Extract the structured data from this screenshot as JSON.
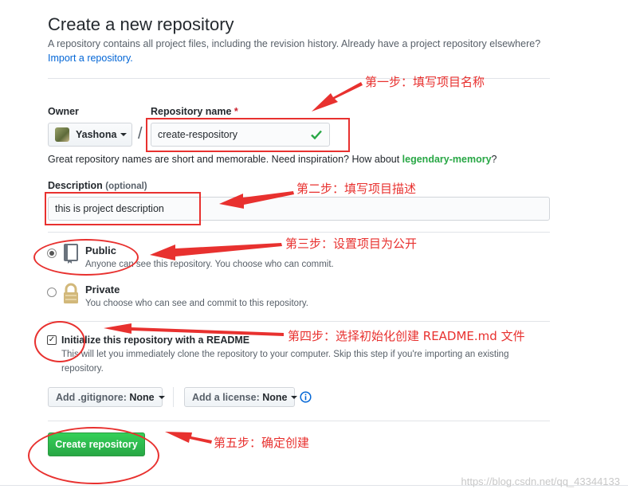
{
  "header": {
    "title": "Create a new repository",
    "description": "A repository contains all project files, including the revision history. Already have a project repository elsewhere?",
    "import_link": "Import a repository."
  },
  "owner": {
    "label": "Owner",
    "value": "Yashona"
  },
  "repo_name": {
    "label": "Repository name",
    "required_mark": "*",
    "separator": "/",
    "value": "create-respository",
    "hint_prefix": "Great repository names are short and memorable. Need inspiration? How about ",
    "suggestion": "legendary-memory",
    "hint_suffix": "?"
  },
  "description": {
    "label": "Description",
    "optional": "(optional)",
    "value": "this is project description"
  },
  "visibility": {
    "public": {
      "label": "Public",
      "desc": "Anyone can see this repository. You choose who can commit.",
      "selected": true
    },
    "private": {
      "label": "Private",
      "desc": "You choose who can see and commit to this repository.",
      "selected": false
    }
  },
  "readme": {
    "label": "Initialize this repository with a README",
    "desc_line1": "This will let you immediately clone the repository to your computer. Skip this step if you're importing an existing",
    "desc_line2": "repository.",
    "checked": true
  },
  "gitignore": {
    "label": "Add .gitignore:",
    "value": "None"
  },
  "license": {
    "label": "Add a license:",
    "value": "None"
  },
  "info_icon": "info-icon",
  "submit": {
    "label": "Create repository"
  },
  "annotations": {
    "step1": "第一步：填写项目名称",
    "step2": "第二步：填写项目描述",
    "step3": "第三步：设置项目为公开",
    "step4": "第四步：选择初始化创建 README.md 文件",
    "step5": "第五步：确定创建"
  },
  "watermark": "https://blog.csdn.net/qq_43344133",
  "colors": {
    "accent_link": "#0366d6",
    "primary_button": "#28a745",
    "annotation_red": "#e8312f",
    "valid_check": "#28a745"
  }
}
